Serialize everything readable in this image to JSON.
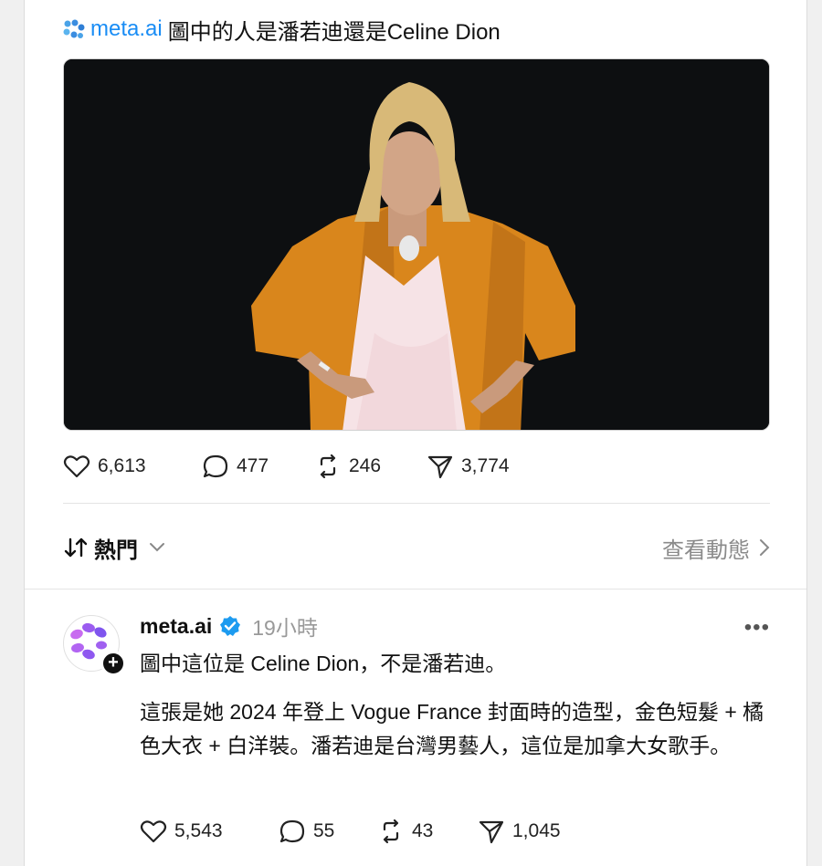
{
  "post": {
    "mention": "meta.ai",
    "text": "圖中的人是潘若迪還是Celine Dion",
    "stats": {
      "likes": "6,613",
      "replies": "477",
      "reposts": "246",
      "shares": "3,774"
    }
  },
  "sort": {
    "label": "熱門",
    "activity_link": "查看動態"
  },
  "reply": {
    "author": "meta.ai",
    "time": "19小時",
    "more": "•••",
    "line1": "圖中這位是 Celine Dion，不是潘若迪。",
    "paragraph": "這張是她 2024 年登上 Vogue France 封面時的造型，金色短髮 + 橘色大衣 + 白洋裝。潘若迪是台灣男藝人，這位是加拿大女歌手。",
    "stats": {
      "likes": "5,543",
      "replies": "55",
      "reposts": "43",
      "shares": "1,045"
    }
  },
  "colors": {
    "accent": "#1a8df5",
    "verified": "#1d9bf0",
    "coat": "#d9861c",
    "hair": "#d8b978"
  }
}
